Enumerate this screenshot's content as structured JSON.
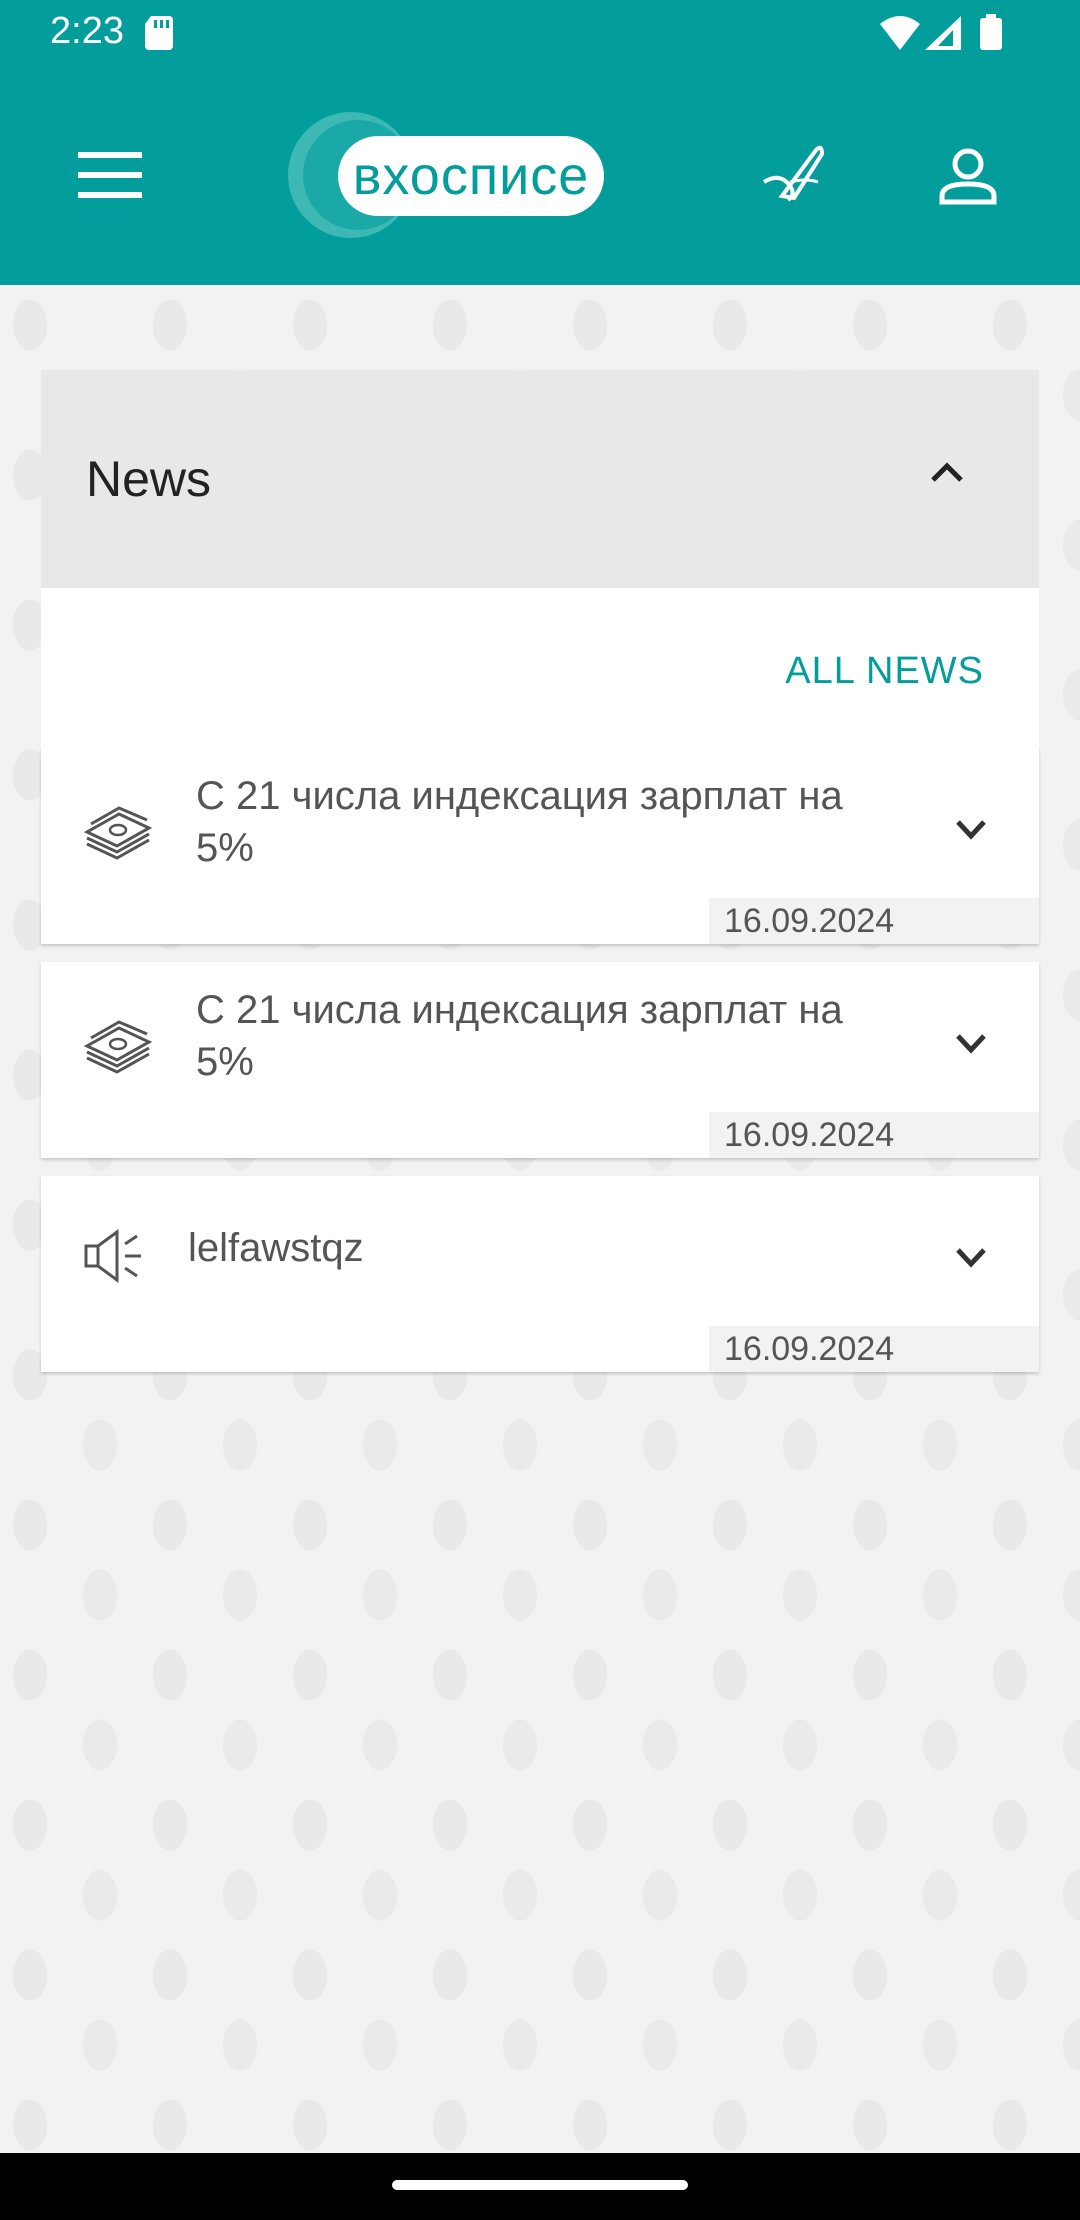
{
  "status_bar": {
    "time": "2:23",
    "icons": [
      "sd-card-icon",
      "wifi-icon",
      "signal-icon",
      "battery-icon"
    ]
  },
  "header": {
    "logo_text": "вхосписе",
    "icons": [
      "menu-icon",
      "signature-icon",
      "user-icon"
    ],
    "accent_color": "#039e9c"
  },
  "news": {
    "title": "News",
    "all_news_label": "ALL NEWS",
    "items": [
      {
        "icon": "money-stack-icon",
        "text": "С 21 числа индексация зарплат на 5%",
        "date": "16.09.2024"
      },
      {
        "icon": "money-stack-icon",
        "text": "С 21 числа индексация зарплат на 5%",
        "date": "16.09.2024"
      },
      {
        "icon": "megaphone-icon",
        "text": "lelfawstqz",
        "date": "16.09.2024"
      }
    ]
  }
}
